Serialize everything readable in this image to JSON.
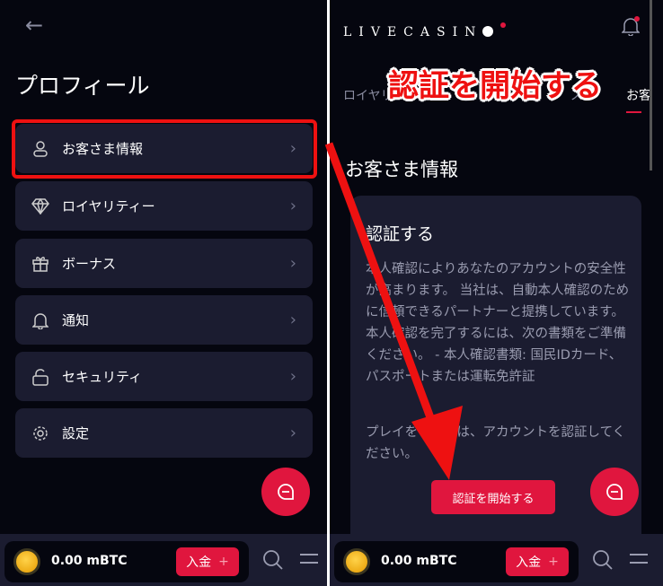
{
  "left": {
    "title": "プロフィール",
    "items": [
      {
        "label": "お客さま情報",
        "icon": "user-icon"
      },
      {
        "label": "ロイヤリティー",
        "icon": "diamond-icon"
      },
      {
        "label": "ボーナス",
        "icon": "gift-icon"
      },
      {
        "label": "通知",
        "icon": "bell-icon"
      },
      {
        "label": "セキュリティ",
        "icon": "lock-icon"
      },
      {
        "label": "設定",
        "icon": "gear-icon"
      }
    ]
  },
  "right": {
    "logo": "LIVECASIN",
    "tabs": [
      "ロイヤリ",
      "ス",
      "お客"
    ],
    "section_title": "お客さま情報",
    "card": {
      "title": "認証する",
      "body1": "本人確認によりあなたのアカウントの安全性が高まります。 当社は、自動本人確認のために信頼できるパートナーと提携しています。 本人確認を完了するには、次の書類をご準備ください。 - 本人確認書類: 国民IDカード、パスポートまたは運転免許証",
      "body2": "プレイをするには、アカウントを認証してください。",
      "button": "認証を開始する"
    }
  },
  "bottom": {
    "balance": "0.00 mBTC",
    "deposit": "入金",
    "plus": "+"
  },
  "annotation": {
    "label": "認証を開始する",
    "color": "#ee1111"
  },
  "colors": {
    "accent": "#e0163e",
    "card": "#1b1c30",
    "bg": "#05060f"
  }
}
